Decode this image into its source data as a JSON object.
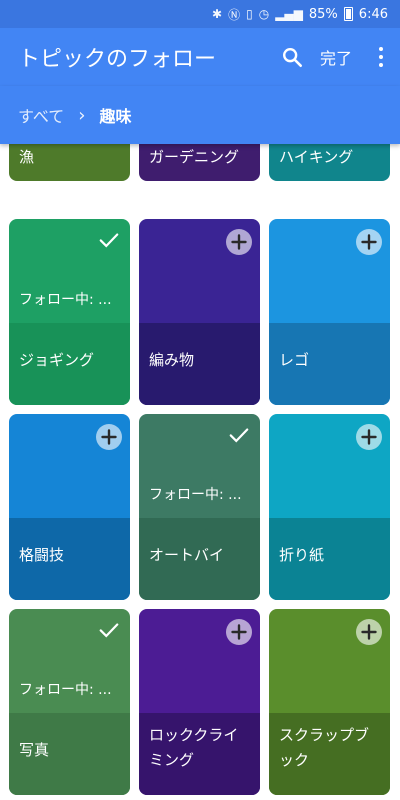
{
  "status_bar": {
    "battery": "85%",
    "time": "6:46"
  },
  "app_bar": {
    "title": "トピックのフォロー",
    "done_label": "完了"
  },
  "breadcrumb": {
    "all": "すべて",
    "current": "趣味"
  },
  "tiles": [
    {
      "label": "漁",
      "state": "partial",
      "color": "#4e7a2a",
      "bottom_color": "#4e7a2a"
    },
    {
      "label": "ガーデニング",
      "state": "partial",
      "color": "#3f1d6e",
      "bottom_color": "#3f1d6e"
    },
    {
      "label": "ハイキング",
      "state": "partial",
      "color": "#10858c",
      "bottom_color": "#10858c"
    },
    {
      "label": "ジョギング",
      "state": "following",
      "following_text": "フォロー中: ...",
      "color": "#1ea064",
      "bottom_color": "#189258"
    },
    {
      "label": "編み物",
      "state": "add",
      "color": "#3a2494",
      "bottom_color": "#281a6e"
    },
    {
      "label": "レゴ",
      "state": "add",
      "color": "#1c95e0",
      "bottom_color": "#1776b3"
    },
    {
      "label": "格闘技",
      "state": "add",
      "color": "#1585d6",
      "bottom_color": "#0e68a8"
    },
    {
      "label": "オートバイ",
      "state": "following",
      "following_text": "フォロー中: ...",
      "color": "#3d7a64",
      "bottom_color": "#316a54"
    },
    {
      "label": "折り紙",
      "state": "add",
      "color": "#0ea6c4",
      "bottom_color": "#0b8394"
    },
    {
      "label": "写真",
      "state": "following",
      "following_text": "フォロー中: ...",
      "color": "#4a8c52",
      "bottom_color": "#3f7a47"
    },
    {
      "label": "ロッククライミング",
      "state": "add",
      "color": "#4c1c94",
      "bottom_color": "#36146c"
    },
    {
      "label": "スクラップブック",
      "state": "add",
      "color": "#5a8e2c",
      "bottom_color": "#456e22"
    }
  ]
}
